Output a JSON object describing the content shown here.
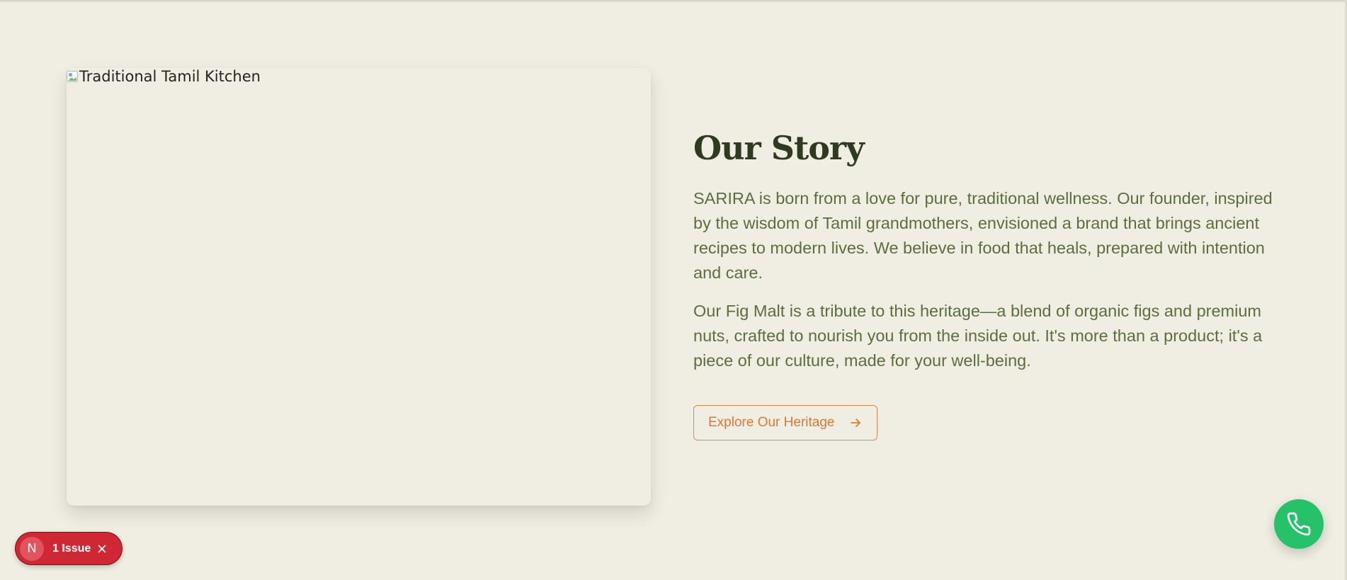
{
  "hero": {
    "image_alt": "Traditional Tamil Kitchen"
  },
  "story": {
    "title": "Our Story",
    "paragraphs": [
      "SARIRA is born from a love for pure, traditional wellness. Our founder, inspired by the wisdom of Tamil grandmothers, envisioned a brand that brings ancient recipes to modern lives. We believe in food that heals, prepared with intention and care.",
      "Our Fig Malt is a tribute to this heritage—a blend of organic figs and premium nuts, crafted to nourish you from the inside out. It's more than a product; it's a piece of our culture, made for your well-being."
    ],
    "cta_label": "Explore Our Heritage",
    "cta_icon": "arrow-right-icon"
  },
  "dev_badge": {
    "logo_letter": "N",
    "issues_label": "1 Issue",
    "close_icon": "close-icon"
  },
  "phone_button": {
    "icon": "phone-icon"
  },
  "colors": {
    "background": "#f0eee2",
    "title": "#2f3b20",
    "body_text": "#5c6d3e",
    "accent": "#d97a36",
    "badge": "#d02734",
    "phone": "#25c26a"
  }
}
